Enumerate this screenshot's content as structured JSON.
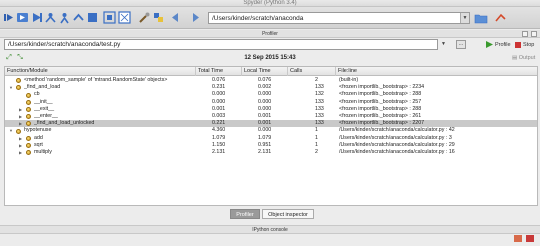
{
  "window": {
    "title": "Spyder (Python 3.4)"
  },
  "toolbar": {
    "working_dir": "/Users/kinder/scratch/anaconda",
    "icons": [
      "step-icon",
      "run-cell-icon",
      "run-icon",
      "debug-icon",
      "step-into-icon",
      "step-return-icon",
      "continue-icon",
      "stop-icon",
      "maximize-pane-icon",
      "fullscreen-icon",
      "tools-icon",
      "python-path-icon",
      "back-arrow-icon",
      "forward-arrow-icon",
      "browse-folder-icon",
      "parent-dir-icon"
    ]
  },
  "profiler": {
    "pane_title": "Profiler",
    "file_path": "/Users/kinder/scratch/anaconda/test.py",
    "browse_label": "...",
    "profile_label": "Profile",
    "stop_label": "Stop",
    "date": "12 Sep 2015 15:43",
    "output_label": "Output",
    "columns": [
      "Function/Module",
      "Total Time",
      "Local Time",
      "Calls",
      "File:line"
    ],
    "rows": [
      {
        "indent": 0,
        "twisty": "",
        "name": "<method 'random_sample' of 'mtrand.RandomState' objects>",
        "total": "0.076",
        "local": "0.076",
        "calls": "2",
        "file": "(built-in)",
        "selected": false
      },
      {
        "indent": 0,
        "twisty": "▼",
        "name": "_find_and_load",
        "total": "0.231",
        "local": "0.002",
        "calls": "133",
        "file": "<frozen importlib._bootstrap> : 2234",
        "selected": false
      },
      {
        "indent": 1,
        "twisty": "",
        "name": "cb",
        "total": "0.000",
        "local": "0.000",
        "calls": "132",
        "file": "<frozen importlib._bootstrap> : 288",
        "selected": false
      },
      {
        "indent": 1,
        "twisty": "",
        "name": "__init__",
        "total": "0.000",
        "local": "0.000",
        "calls": "133",
        "file": "<frozen importlib._bootstrap> : 257",
        "selected": false
      },
      {
        "indent": 1,
        "twisty": "▶",
        "name": "__exit__",
        "total": "0.001",
        "local": "0.000",
        "calls": "133",
        "file": "<frozen importlib._bootstrap> : 288",
        "selected": false
      },
      {
        "indent": 1,
        "twisty": "▶",
        "name": "__enter__",
        "total": "0.003",
        "local": "0.001",
        "calls": "133",
        "file": "<frozen importlib._bootstrap> : 261",
        "selected": false
      },
      {
        "indent": 1,
        "twisty": "▶",
        "name": "_find_and_load_unlocked",
        "total": "0.221",
        "local": "0.001",
        "calls": "133",
        "file": "<frozen importlib._bootstrap> : 2207",
        "selected": true
      },
      {
        "indent": 0,
        "twisty": "▼",
        "name": "hypotenuse",
        "total": "4.360",
        "local": "0.000",
        "calls": "1",
        "file": "/Users/kinder/scratch/anaconda/calculator.py : 42",
        "selected": false
      },
      {
        "indent": 1,
        "twisty": "▶",
        "name": "add",
        "total": "1.079",
        "local": "1.079",
        "calls": "1",
        "file": "/Users/kinder/scratch/anaconda/calculator.py : 3",
        "selected": false
      },
      {
        "indent": 1,
        "twisty": "▶",
        "name": "sqrt",
        "total": "1.150",
        "local": "0.951",
        "calls": "1",
        "file": "/Users/kinder/scratch/anaconda/calculator.py : 29",
        "selected": false
      },
      {
        "indent": 1,
        "twisty": "▶",
        "name": "multiply",
        "total": "2.131",
        "local": "2.131",
        "calls": "2",
        "file": "/Users/kinder/scratch/anaconda/calculator.py : 16",
        "selected": false
      }
    ]
  },
  "tabs": [
    {
      "label": "Profiler",
      "active": true
    },
    {
      "label": "Object inspector",
      "active": false
    }
  ],
  "console": {
    "title": "IPython console"
  }
}
